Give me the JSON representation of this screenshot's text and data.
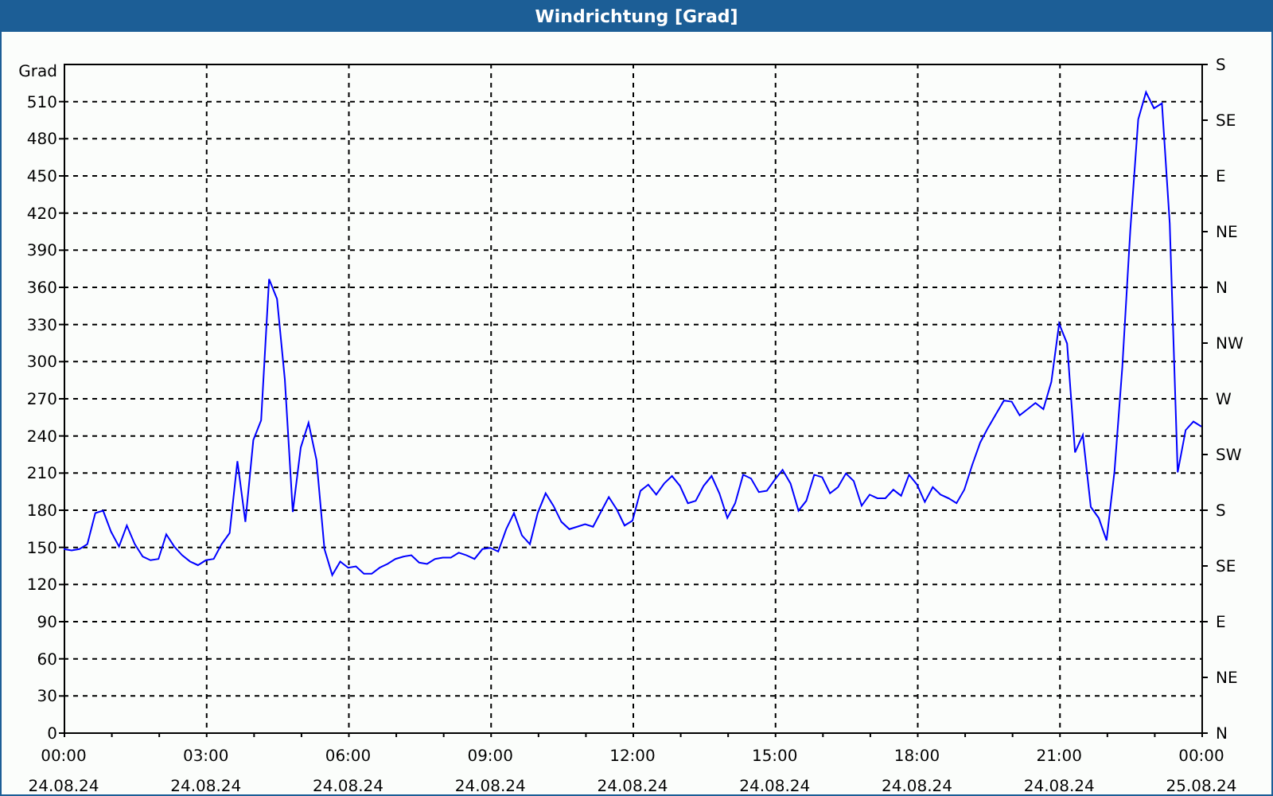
{
  "chart_data": {
    "type": "line",
    "title": "Windrichtung [Grad]",
    "ylabel": "Grad",
    "ylim": [
      0,
      540
    ],
    "grid": true,
    "yticks": [
      0,
      30,
      60,
      90,
      120,
      150,
      180,
      210,
      240,
      270,
      300,
      330,
      360,
      390,
      420,
      450,
      480,
      510
    ],
    "categories": [
      "00:00 24.08.24",
      null,
      null,
      null,
      null,
      null,
      null,
      null,
      null,
      null,
      null,
      null,
      null,
      null,
      null,
      null,
      null,
      null,
      "03:00 24.08.24",
      null,
      null,
      null,
      null,
      null,
      null,
      null,
      null,
      null,
      null,
      null,
      null,
      null,
      null,
      null,
      null,
      null,
      "06:00 24.08.24",
      null,
      null,
      null,
      null,
      null,
      null,
      null,
      null,
      null,
      null,
      null,
      null,
      null,
      null,
      null,
      null,
      null,
      "09:00 24.08.24",
      null,
      null,
      null,
      null,
      null,
      null,
      null,
      null,
      null,
      null,
      null,
      null,
      null,
      null,
      null,
      null,
      null,
      "12:00 24.08.24",
      null,
      null,
      null,
      null,
      null,
      null,
      null,
      null,
      null,
      null,
      null,
      null,
      null,
      null,
      null,
      null,
      null,
      "15:00 24.08.24",
      null,
      null,
      null,
      null,
      null,
      null,
      null,
      null,
      null,
      null,
      null,
      null,
      null,
      null,
      null,
      null,
      null,
      "18:00 24.08.24",
      null,
      null,
      null,
      null,
      null,
      null,
      null,
      null,
      null,
      null,
      null,
      null,
      null,
      null,
      null,
      null,
      null,
      "21:00 24.08.24",
      null,
      null,
      null,
      null,
      null,
      null,
      null,
      null,
      null,
      null,
      null,
      null,
      null,
      null,
      null,
      null,
      null,
      "00:00 25.08.24"
    ],
    "series": [
      {
        "color": "#0000ff",
        "values": [
          148,
          147,
          148,
          152,
          177,
          179,
          162,
          150,
          167,
          152,
          142,
          139,
          140,
          160,
          150,
          143,
          138,
          135,
          139,
          140,
          152,
          161,
          219,
          170,
          236,
          252,
          366,
          350,
          285,
          178,
          230,
          250,
          220,
          148,
          127,
          138,
          133,
          134,
          128,
          128,
          133,
          136,
          140,
          142,
          143,
          137,
          136,
          140,
          141,
          141,
          145,
          143,
          140,
          148,
          149,
          146,
          164,
          177,
          159,
          152,
          177,
          193,
          183,
          170,
          164,
          166,
          168,
          166,
          178,
          190,
          180,
          167,
          171,
          195,
          200,
          192,
          201,
          207,
          199,
          185,
          187,
          199,
          207,
          193,
          173,
          185,
          208,
          205,
          194,
          195,
          204,
          212,
          201,
          179,
          187,
          208,
          206,
          193,
          198,
          209,
          203,
          183,
          192,
          189,
          189,
          196,
          191,
          208,
          200,
          186,
          198,
          192,
          189,
          185,
          196,
          216,
          234,
          246,
          257,
          268,
          267,
          256,
          261,
          266,
          261,
          283,
          330,
          314,
          226,
          240,
          182,
          173,
          155,
          211,
          295,
          405,
          495,
          517,
          504,
          508,
          411,
          210,
          244,
          251,
          247
        ]
      }
    ]
  },
  "right_axis_labels": [
    "S",
    "SE",
    "E",
    "NE",
    "N",
    "NW",
    "W",
    "SW",
    "S",
    "SE",
    "E",
    "NE",
    "N"
  ]
}
